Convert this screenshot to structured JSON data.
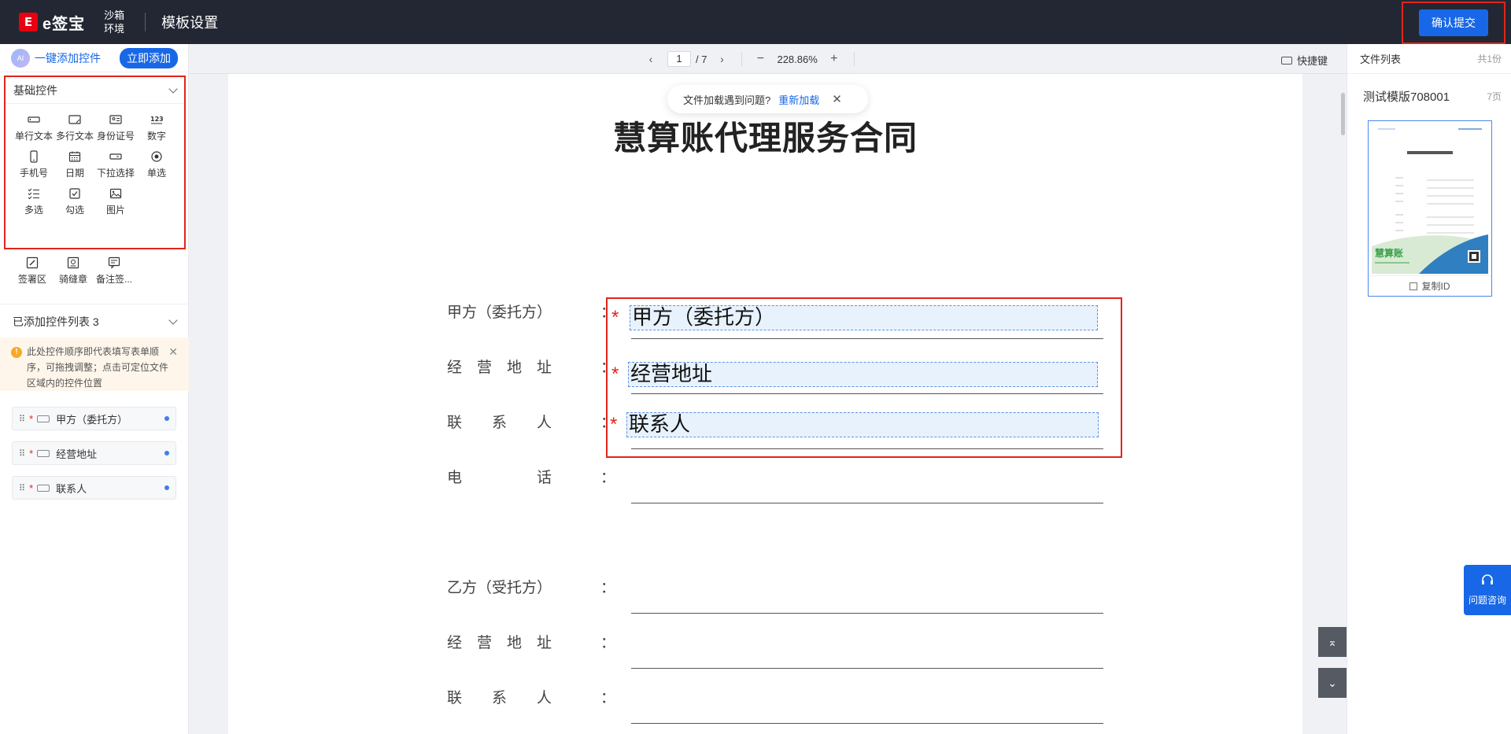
{
  "header": {
    "logo_mark": "E",
    "logo_text": "e签宝",
    "environment": "沙箱环境",
    "page_title": "模板设置",
    "submit_label": "确认提交"
  },
  "left_panel": {
    "quick_add_icon": "AI",
    "quick_add_label": "一键添加控件",
    "quick_add_button": "立即添加",
    "basic_section_title": "基础控件",
    "basic_controls": [
      {
        "label": "单行文本",
        "icon": "single-line-text-icon"
      },
      {
        "label": "多行文本",
        "icon": "multi-line-text-icon"
      },
      {
        "label": "身份证号",
        "icon": "id-card-icon"
      },
      {
        "label": "数字",
        "icon": "number-icon"
      },
      {
        "label": "手机号",
        "icon": "mobile-icon"
      },
      {
        "label": "日期",
        "icon": "calendar-icon"
      },
      {
        "label": "下拉选择",
        "icon": "dropdown-icon"
      },
      {
        "label": "单选",
        "icon": "radio-icon"
      },
      {
        "label": "多选",
        "icon": "multi-select-icon"
      },
      {
        "label": "勾选",
        "icon": "checkbox-icon"
      },
      {
        "label": "图片",
        "icon": "image-icon"
      }
    ],
    "sign_controls": [
      {
        "label": "签署区",
        "icon": "sign-area-icon"
      },
      {
        "label": "骑缝章",
        "icon": "seam-seal-icon"
      },
      {
        "label": "备注签...",
        "icon": "remark-sign-icon"
      }
    ],
    "added_section_title": "已添加控件列表 3",
    "tip_icon": "!",
    "tip_text": "此处控件顺序即代表填写表单顺序，可拖拽调整；点击可定位文件区域内的控件位置",
    "tip_close": "✕",
    "added_items": [
      {
        "label": "甲方（委托方）"
      },
      {
        "label": "经营地址"
      },
      {
        "label": "联系人"
      }
    ]
  },
  "toolbar": {
    "prev_page": "‹",
    "current_page": "1",
    "total_pages": "/ 7",
    "next_page": "›",
    "zoom_out": "−",
    "zoom_level": "228.86%",
    "zoom_in": "+",
    "shortcut_label": "快捷键"
  },
  "toast": {
    "message": "文件加载遇到问题?",
    "reload": "重新加载",
    "close": "✕"
  },
  "document": {
    "title": "慧算账代理服务合同",
    "rows": [
      {
        "label": "甲方（委托方）",
        "colon": "："
      },
      {
        "label": "经　营　地　址",
        "colon": "："
      },
      {
        "label": "联　　系　　人",
        "colon": "："
      },
      {
        "label": "电　　　　　话",
        "colon": "："
      },
      {
        "label": "乙方（受托方）",
        "colon": "："
      },
      {
        "label": "经　营　地　址",
        "colon": "："
      },
      {
        "label": "联　　系　　人",
        "colon": "："
      }
    ],
    "fields": [
      {
        "text": "甲方（委托方）",
        "star": "*"
      },
      {
        "text": "经营地址",
        "star": "*"
      },
      {
        "text": "联系人",
        "star": "*"
      }
    ],
    "scroll_top": "⌅",
    "scroll_bottom": "⌄"
  },
  "right_panel": {
    "title": "文件列表",
    "count": "共1份",
    "file_name": "测试模版708001",
    "file_pages": "7页",
    "copy_id": "复制ID",
    "thumb_brand": "慧算账"
  },
  "help_label": "问题咨询",
  "colors": {
    "primary": "#1867e6",
    "highlight_border": "#e1251b",
    "topbar": "#232733"
  }
}
